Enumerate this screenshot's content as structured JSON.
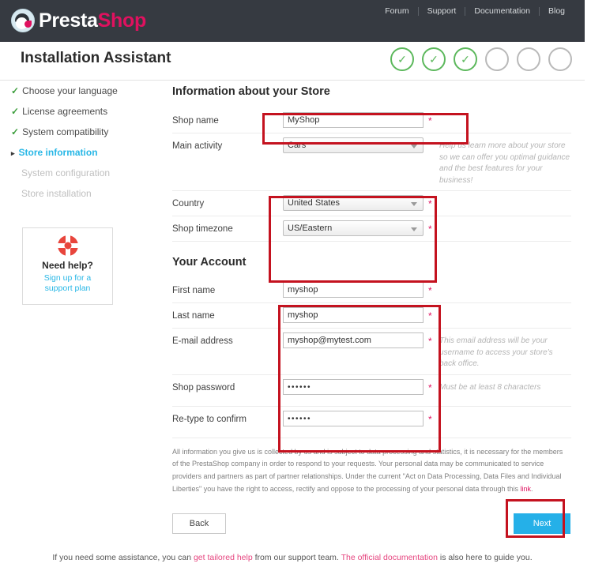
{
  "brand": {
    "name_first": "Presta",
    "name_second": "Shop",
    "logo_icon": "prestashop-avatar-icon"
  },
  "topnav": {
    "links": [
      "Forum",
      "Support",
      "Documentation",
      "Blog"
    ]
  },
  "header": {
    "title": "Installation Assistant",
    "steps": [
      {
        "state": "done",
        "icon": "check-icon"
      },
      {
        "state": "done",
        "icon": "check-icon"
      },
      {
        "state": "done",
        "icon": "check-icon"
      },
      {
        "state": "pending",
        "icon": ""
      },
      {
        "state": "pending",
        "icon": ""
      },
      {
        "state": "pending",
        "icon": ""
      }
    ]
  },
  "sidebar": {
    "items": [
      {
        "label": "Choose your language",
        "state": "done",
        "tick": "✓"
      },
      {
        "label": "License agreements",
        "state": "done",
        "tick": "✓"
      },
      {
        "label": "System compatibility",
        "state": "done",
        "tick": "✓"
      },
      {
        "label": "Store information",
        "state": "current",
        "arrow": "▸"
      },
      {
        "label": "System configuration",
        "state": "future"
      },
      {
        "label": "Store installation",
        "state": "future"
      }
    ],
    "help": {
      "icon": "life-ring-icon",
      "title": "Need help?",
      "link_line1": "Sign up for a",
      "link_line2": "support plan"
    }
  },
  "store_section": {
    "title": "Information about your Store",
    "fields": [
      {
        "label": "Shop name",
        "type": "text",
        "value": "MyShop",
        "required_marker": "*",
        "hint": ""
      },
      {
        "label": "Main activity",
        "type": "select",
        "value": "Cars",
        "required_marker": "",
        "hint": "Help us learn more about your store so we can offer you optimal guidance and the best features for your business!"
      },
      {
        "label": "Country",
        "type": "select",
        "value": "United States",
        "required_marker": "*",
        "hint": ""
      },
      {
        "label": "Shop timezone",
        "type": "select",
        "value": "US/Eastern",
        "required_marker": "*",
        "hint": ""
      }
    ]
  },
  "account_section": {
    "title": "Your Account",
    "fields": [
      {
        "label": "First name",
        "type": "text",
        "value": "myshop",
        "required_marker": "*",
        "hint": ""
      },
      {
        "label": "Last name",
        "type": "text",
        "value": "myshop",
        "required_marker": "*",
        "hint": ""
      },
      {
        "label": "E-mail address",
        "type": "text",
        "value": "myshop@mytest.com",
        "required_marker": "*",
        "hint": "This email address will be your username to access your store's back office."
      },
      {
        "label": "Shop password",
        "type": "password",
        "value": "••••••",
        "required_marker": "*",
        "hint": "Must be at least 8 characters"
      },
      {
        "label": "Re-type to confirm",
        "type": "password",
        "value": "••••••",
        "required_marker": "*",
        "hint": ""
      }
    ]
  },
  "legal": {
    "text_before_link": "All information you give us is collected by us and is subject to data processing and statistics, it is necessary for the members of the PrestaShop company in order to respond to your requests. Your personal data may be communicated to service providers and partners as part of partner relationships. Under the current \"Act on Data Processing, Data Files and Individual Liberties\" you have the right to access, rectify and oppose to the processing of your personal data through this ",
    "link_label": "link",
    "text_after_link": "."
  },
  "buttons": {
    "back": "Back",
    "next": "Next"
  },
  "footer": {
    "text_1": "If you need some assistance, you can ",
    "link_1": "get tailored help",
    "text_2": " from our support team. ",
    "link_2": "The official documentation",
    "text_3": " is also here to guide you."
  },
  "annotations": {
    "accent_color": "#c4121f",
    "boxes": [
      "shop-name-highlight",
      "country-timezone-highlight",
      "account-fields-highlight",
      "next-button-highlight"
    ]
  }
}
